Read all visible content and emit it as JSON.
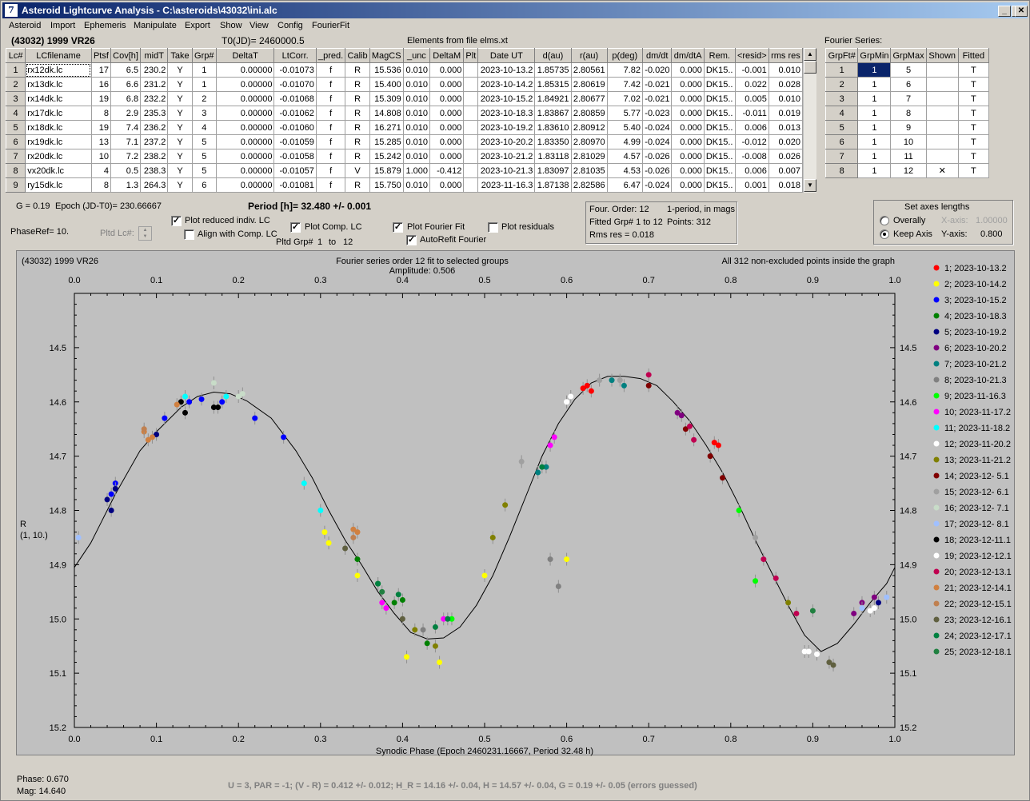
{
  "window": {
    "title": "Asteroid Lightcurve Analysis - C:\\asteroids\\43032\\ini.alc",
    "icon": "app-7-icon"
  },
  "menu": [
    "Asteroid",
    "Import",
    "Ephemeris",
    "Manipulate",
    "Export",
    "Show",
    "View",
    "Config",
    "FourierFit"
  ],
  "header": {
    "object": "(43032) 1999 VR26",
    "t0": "T0(JD)= 2460000.5",
    "elements": "Elements from file elms.xt",
    "fourier_label": "Fourier Series:"
  },
  "lc_table": {
    "columns": [
      "Lc#",
      "LCfilename",
      "Ptsf",
      "Cov[h]",
      "midT",
      "Take",
      "Grp#",
      "DeltaT",
      "LtCorr.",
      "_pred.",
      "Calib",
      "MagCS",
      "_unc",
      "DeltaM",
      "Plt",
      "Date UT",
      "d(au)",
      "r(au)",
      "p(deg)",
      "dm/dt",
      "dm/dtA",
      "Rem.",
      "<resid>",
      "rms res"
    ],
    "rows": [
      [
        "1",
        "rx12dk.lc",
        "17",
        "6.5",
        "230.2",
        "Y",
        "1",
        "0.00000",
        "-0.01073",
        "f",
        "R",
        "15.536",
        "0.010",
        "0.000",
        "",
        "2023-10-13.2",
        "1.85735",
        "2.80561",
        "7.82",
        "-0.020",
        "0.000",
        "DK15..",
        "-0.001",
        "0.010"
      ],
      [
        "2",
        "rx13dk.lc",
        "16",
        "6.6",
        "231.2",
        "Y",
        "1",
        "0.00000",
        "-0.01070",
        "f",
        "R",
        "15.400",
        "0.010",
        "0.000",
        "",
        "2023-10-14.2",
        "1.85315",
        "2.80619",
        "7.42",
        "-0.021",
        "0.000",
        "DK15..",
        "0.022",
        "0.028"
      ],
      [
        "3",
        "rx14dk.lc",
        "19",
        "6.8",
        "232.2",
        "Y",
        "2",
        "0.00000",
        "-0.01068",
        "f",
        "R",
        "15.309",
        "0.010",
        "0.000",
        "",
        "2023-10-15.2",
        "1.84921",
        "2.80677",
        "7.02",
        "-0.021",
        "0.000",
        "DK15..",
        "0.005",
        "0.010"
      ],
      [
        "4",
        "rx17dk.lc",
        "8",
        "2.9",
        "235.3",
        "Y",
        "3",
        "0.00000",
        "-0.01062",
        "f",
        "R",
        "14.808",
        "0.010",
        "0.000",
        "",
        "2023-10-18.3",
        "1.83867",
        "2.80859",
        "5.77",
        "-0.023",
        "0.000",
        "DK15..",
        "-0.011",
        "0.019"
      ],
      [
        "5",
        "rx18dk.lc",
        "19",
        "7.4",
        "236.2",
        "Y",
        "4",
        "0.00000",
        "-0.01060",
        "f",
        "R",
        "16.271",
        "0.010",
        "0.000",
        "",
        "2023-10-19.2",
        "1.83610",
        "2.80912",
        "5.40",
        "-0.024",
        "0.000",
        "DK15..",
        "0.006",
        "0.013"
      ],
      [
        "6",
        "rx19dk.lc",
        "13",
        "7.1",
        "237.2",
        "Y",
        "5",
        "0.00000",
        "-0.01059",
        "f",
        "R",
        "15.285",
        "0.010",
        "0.000",
        "",
        "2023-10-20.2",
        "1.83350",
        "2.80970",
        "4.99",
        "-0.024",
        "0.000",
        "DK15..",
        "-0.012",
        "0.020"
      ],
      [
        "7",
        "rx20dk.lc",
        "10",
        "7.2",
        "238.2",
        "Y",
        "5",
        "0.00000",
        "-0.01058",
        "f",
        "R",
        "15.242",
        "0.010",
        "0.000",
        "",
        "2023-10-21.2",
        "1.83118",
        "2.81029",
        "4.57",
        "-0.026",
        "0.000",
        "DK15..",
        "-0.008",
        "0.026"
      ],
      [
        "8",
        "vx20dk.lc",
        "4",
        "0.5",
        "238.3",
        "Y",
        "5",
        "0.00000",
        "-0.01057",
        "f",
        "V",
        "15.879",
        "1.000",
        "-0.412",
        "",
        "2023-10-21.3",
        "1.83097",
        "2.81035",
        "4.53",
        "-0.026",
        "0.000",
        "DK15..",
        "0.006",
        "0.007"
      ],
      [
        "9",
        "ry15dk.lc",
        "8",
        "1.3",
        "264.3",
        "Y",
        "6",
        "0.00000",
        "-0.01081",
        "f",
        "R",
        "15.750",
        "0.010",
        "0.000",
        "",
        "2023-11-16.3",
        "1.87138",
        "2.82586",
        "6.47",
        "-0.024",
        "0.000",
        "DK15..",
        "0.001",
        "0.018"
      ]
    ]
  },
  "fourier_table": {
    "columns": [
      "GrpFt#",
      "GrpMin",
      "GrpMax",
      "Shown",
      "Fitted"
    ],
    "rows": [
      [
        "1",
        "1",
        "5",
        "",
        "T"
      ],
      [
        "2",
        "1",
        "6",
        "",
        "T"
      ],
      [
        "3",
        "1",
        "7",
        "",
        "T"
      ],
      [
        "4",
        "1",
        "8",
        "",
        "T"
      ],
      [
        "5",
        "1",
        "9",
        "",
        "T"
      ],
      [
        "6",
        "1",
        "10",
        "",
        "T"
      ],
      [
        "7",
        "1",
        "11",
        "",
        "T"
      ],
      [
        "8",
        "1",
        "12",
        "✕",
        "T"
      ]
    ]
  },
  "controls": {
    "g_label": "G = 0.19",
    "epoch_label": "Epoch (JD-T0)= 230.66667",
    "period_label": "Period [h]= 32.480 +/- 0.001",
    "phaseref": "PhaseRef= 10.",
    "pltd_lc": "Pltd Lc#:",
    "plot_reduced": "Plot reduced indiv. LC",
    "align_comp": "Align with Comp. LC",
    "plot_comp": "Plot Comp. LC",
    "pltd_grp": "Pltd Grp#",
    "grp_from": "1",
    "grp_to_label": "to",
    "grp_to": "12",
    "plot_fourier": "Plot Fourier Fit",
    "autorefit": "AutoRefit Fourier",
    "plot_residuals": "Plot residuals",
    "info_order": "Four. Order: 12",
    "info_period": "1-period, in mags",
    "info_fitted": "Fitted Grp# 1 to 12",
    "info_points": "Points: 312",
    "info_rms": "Rms res    = 0.018",
    "axes_title": "Set axes lengths",
    "overally": "Overally",
    "keep_axis": "Keep Axis",
    "xaxis_label": "X-axis:",
    "xaxis_val": "1.00000",
    "yaxis_label": "Y-axis:",
    "yaxis_val": "0.800",
    "check_mark": "✓"
  },
  "chart_data": {
    "type": "scatter",
    "title_left": "(43032) 1999 VR26",
    "title_center": "Fourier series order 12 fit to selected groups",
    "subtitle": "Amplitude: 0.506",
    "title_right": "All 312 non-excluded points inside the graph",
    "xlabel": "Synodic Phase (Epoch 2460231.16667, Period 32.48 h)",
    "ylabel": "R",
    "ylabel2": "(1, 10.)",
    "xlim": [
      0,
      1
    ],
    "ylim": [
      15.2,
      14.4
    ],
    "xticks": [
      "0.0",
      "0.1",
      "0.2",
      "0.3",
      "0.4",
      "0.5",
      "0.6",
      "0.7",
      "0.8",
      "0.9",
      "1.0"
    ],
    "yticks": [
      "14.5",
      "14.6",
      "14.7",
      "14.8",
      "14.9",
      "15.0",
      "15.1",
      "15.2"
    ],
    "fit_curve": [
      [
        0.0,
        14.905
      ],
      [
        0.02,
        14.86
      ],
      [
        0.05,
        14.77
      ],
      [
        0.08,
        14.69
      ],
      [
        0.1,
        14.655
      ],
      [
        0.13,
        14.61
      ],
      [
        0.15,
        14.59
      ],
      [
        0.17,
        14.582
      ],
      [
        0.19,
        14.585
      ],
      [
        0.21,
        14.598
      ],
      [
        0.24,
        14.63
      ],
      [
        0.27,
        14.69
      ],
      [
        0.29,
        14.74
      ],
      [
        0.31,
        14.8
      ],
      [
        0.33,
        14.855
      ],
      [
        0.35,
        14.9
      ],
      [
        0.37,
        14.95
      ],
      [
        0.39,
        14.99
      ],
      [
        0.41,
        15.025
      ],
      [
        0.43,
        15.037
      ],
      [
        0.45,
        15.035
      ],
      [
        0.47,
        15.015
      ],
      [
        0.49,
        14.975
      ],
      [
        0.51,
        14.92
      ],
      [
        0.53,
        14.85
      ],
      [
        0.55,
        14.775
      ],
      [
        0.57,
        14.7
      ],
      [
        0.59,
        14.64
      ],
      [
        0.61,
        14.595
      ],
      [
        0.63,
        14.565
      ],
      [
        0.65,
        14.553
      ],
      [
        0.67,
        14.553
      ],
      [
        0.69,
        14.557
      ],
      [
        0.71,
        14.57
      ],
      [
        0.73,
        14.6
      ],
      [
        0.75,
        14.635
      ],
      [
        0.77,
        14.68
      ],
      [
        0.79,
        14.73
      ],
      [
        0.81,
        14.79
      ],
      [
        0.83,
        14.855
      ],
      [
        0.85,
        14.915
      ],
      [
        0.87,
        14.975
      ],
      [
        0.89,
        15.03
      ],
      [
        0.91,
        15.06
      ],
      [
        0.93,
        15.045
      ],
      [
        0.95,
        15.01
      ],
      [
        0.97,
        14.97
      ],
      [
        0.99,
        14.935
      ],
      [
        1.0,
        14.905
      ]
    ],
    "series": [
      {
        "name": "1; 2023-10-13.2",
        "color": "#ff0000",
        "points": [
          [
            0.625,
            14.57
          ],
          [
            0.63,
            14.58
          ],
          [
            0.78,
            14.675
          ],
          [
            0.785,
            14.68
          ],
          [
            0.62,
            14.575
          ]
        ]
      },
      {
        "name": "2; 2023-10-14.2",
        "color": "#ffff00",
        "points": [
          [
            0.305,
            14.84
          ],
          [
            0.31,
            14.86
          ],
          [
            0.345,
            14.92
          ],
          [
            0.405,
            15.07
          ],
          [
            0.445,
            15.08
          ],
          [
            0.5,
            14.92
          ],
          [
            0.6,
            14.89
          ]
        ]
      },
      {
        "name": "3; 2023-10-15.2",
        "color": "#0000ff",
        "points": [
          [
            0.045,
            14.77
          ],
          [
            0.05,
            14.75
          ],
          [
            0.11,
            14.63
          ],
          [
            0.14,
            14.6
          ],
          [
            0.155,
            14.595
          ],
          [
            0.18,
            14.6
          ],
          [
            0.22,
            14.63
          ],
          [
            0.255,
            14.665
          ]
        ]
      },
      {
        "name": "4; 2023-10-18.3",
        "color": "#008000",
        "points": [
          [
            0.345,
            14.89
          ],
          [
            0.37,
            14.935
          ],
          [
            0.39,
            14.97
          ],
          [
            0.4,
            14.965
          ],
          [
            0.43,
            15.045
          ]
        ]
      },
      {
        "name": "5; 2023-10-19.2",
        "color": "#000080",
        "points": [
          [
            0.04,
            14.78
          ],
          [
            0.045,
            14.8
          ],
          [
            0.05,
            14.76
          ],
          [
            0.1,
            14.66
          ],
          [
            0.98,
            14.97
          ]
        ]
      },
      {
        "name": "6; 2023-10-20.2",
        "color": "#800080",
        "points": [
          [
            0.735,
            14.62
          ],
          [
            0.74,
            14.625
          ],
          [
            0.95,
            14.99
          ],
          [
            0.96,
            14.97
          ],
          [
            0.975,
            14.96
          ]
        ]
      },
      {
        "name": "7; 2023-10-21.2",
        "color": "#008080",
        "points": [
          [
            0.565,
            14.73
          ],
          [
            0.575,
            14.72
          ],
          [
            0.655,
            14.56
          ],
          [
            0.67,
            14.57
          ]
        ]
      },
      {
        "name": "8; 2023-10-21.3",
        "color": "#808080",
        "points": [
          [
            0.425,
            15.02
          ],
          [
            0.58,
            14.89
          ],
          [
            0.59,
            14.94
          ]
        ]
      },
      {
        "name": "9; 2023-11-16.3",
        "color": "#00ff00",
        "points": [
          [
            0.46,
            15.0
          ],
          [
            0.81,
            14.8
          ],
          [
            0.83,
            14.93
          ]
        ]
      },
      {
        "name": "10; 2023-11-17.2",
        "color": "#ff00ff",
        "points": [
          [
            0.375,
            14.97
          ],
          [
            0.38,
            14.98
          ],
          [
            0.45,
            15.0
          ],
          [
            0.58,
            14.68
          ],
          [
            0.585,
            14.665
          ]
        ]
      },
      {
        "name": "11; 2023-11-18.2",
        "color": "#00ffff",
        "points": [
          [
            0.135,
            14.59
          ],
          [
            0.185,
            14.59
          ],
          [
            0.28,
            14.75
          ],
          [
            0.3,
            14.8
          ]
        ]
      },
      {
        "name": "12; 2023-11-20.2",
        "color": "#ffffff",
        "points": [
          [
            0.6,
            14.6
          ],
          [
            0.89,
            15.06
          ],
          [
            0.905,
            15.065
          ],
          [
            0.975,
            14.98
          ]
        ]
      },
      {
        "name": "13; 2023-11-21.2",
        "color": "#808000",
        "points": [
          [
            0.415,
            15.02
          ],
          [
            0.44,
            15.05
          ],
          [
            0.51,
            14.85
          ],
          [
            0.525,
            14.79
          ],
          [
            0.87,
            14.97
          ]
        ]
      },
      {
        "name": "14; 2023-12- 5.1",
        "color": "#800000",
        "points": [
          [
            0.7,
            14.57
          ],
          [
            0.745,
            14.65
          ],
          [
            0.775,
            14.7
          ],
          [
            0.79,
            14.74
          ]
        ]
      },
      {
        "name": "15; 2023-12- 6.1",
        "color": "#a0a0a0",
        "points": [
          [
            0.545,
            14.71
          ],
          [
            0.64,
            14.56
          ],
          [
            0.665,
            14.56
          ],
          [
            0.83,
            14.85
          ]
        ]
      },
      {
        "name": "16; 2023-12- 7.1",
        "color": "#c8dcc8",
        "points": [
          [
            0.17,
            14.565
          ],
          [
            0.2,
            14.59
          ],
          [
            0.205,
            14.585
          ]
        ]
      },
      {
        "name": "17; 2023-12- 8.1",
        "color": "#a0c0ff",
        "points": [
          [
            0.005,
            14.85
          ],
          [
            0.96,
            14.98
          ],
          [
            0.99,
            14.96
          ]
        ]
      },
      {
        "name": "18; 2023-12-11.1",
        "color": "#000000",
        "points": [
          [
            0.13,
            14.6
          ],
          [
            0.135,
            14.62
          ],
          [
            0.17,
            14.61
          ],
          [
            0.175,
            14.61
          ]
        ]
      },
      {
        "name": "19; 2023-12-12.1",
        "color": "#ffffff",
        "points": [
          [
            0.6,
            14.6
          ],
          [
            0.605,
            14.59
          ],
          [
            0.895,
            15.06
          ],
          [
            0.97,
            14.985
          ]
        ]
      },
      {
        "name": "20; 2023-12-13.1",
        "color": "#c00050",
        "points": [
          [
            0.7,
            14.55
          ],
          [
            0.75,
            14.645
          ],
          [
            0.755,
            14.67
          ],
          [
            0.84,
            14.89
          ],
          [
            0.855,
            14.925
          ],
          [
            0.88,
            14.99
          ]
        ]
      },
      {
        "name": "21; 2023-12-14.1",
        "color": "#d08040",
        "points": [
          [
            0.085,
            14.655
          ],
          [
            0.09,
            14.67
          ],
          [
            0.095,
            14.665
          ],
          [
            0.125,
            14.605
          ],
          [
            0.34,
            14.835
          ],
          [
            0.345,
            14.84
          ]
        ]
      },
      {
        "name": "22; 2023-12-15.1",
        "color": "#c08050",
        "points": [
          [
            0.085,
            14.65
          ],
          [
            0.34,
            14.85
          ]
        ]
      },
      {
        "name": "23; 2023-12-16.1",
        "color": "#606040",
        "points": [
          [
            0.33,
            14.87
          ],
          [
            0.4,
            15.0
          ],
          [
            0.92,
            15.08
          ],
          [
            0.925,
            15.085
          ]
        ]
      },
      {
        "name": "24; 2023-12-17.1",
        "color": "#008040",
        "points": [
          [
            0.37,
            14.935
          ],
          [
            0.395,
            14.955
          ],
          [
            0.44,
            15.015
          ],
          [
            0.455,
            15.0
          ],
          [
            0.57,
            14.72
          ]
        ]
      },
      {
        "name": "25; 2023-12-18.1",
        "color": "#208040",
        "points": [
          [
            0.375,
            14.95
          ],
          [
            0.9,
            14.985
          ]
        ]
      }
    ]
  },
  "status": {
    "phase": "Phase:  0.670",
    "mag": "Mag:    14.640",
    "summary": "U = 3, PAR = -1; (V - R) = 0.412 +/- 0.012; H_R = 14.16 +/- 0.04, H = 14.57 +/- 0.04, G = 0.19 +/- 0.05 (errors guessed)"
  }
}
